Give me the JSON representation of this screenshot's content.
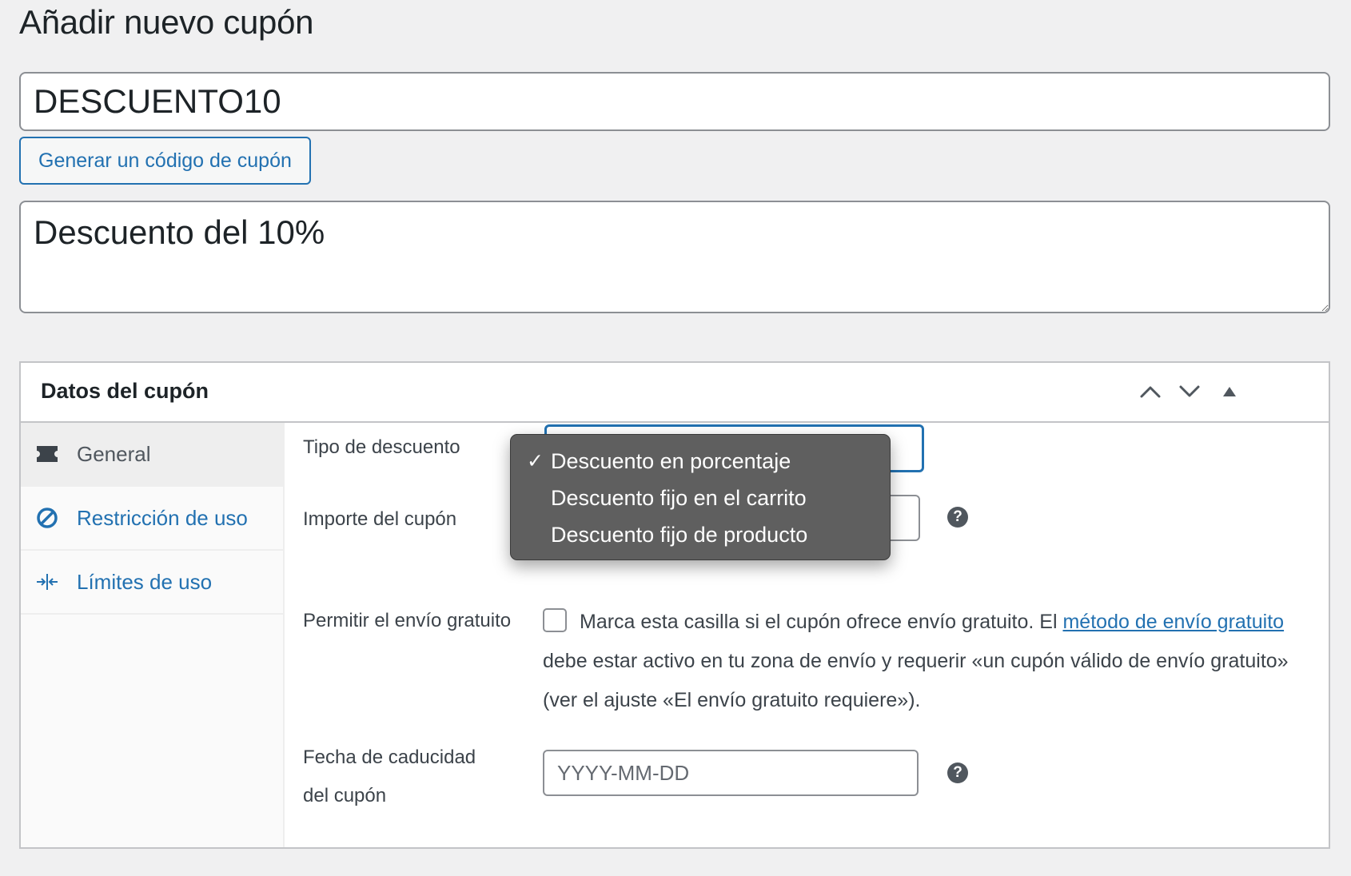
{
  "page": {
    "title": "Añadir nuevo cupón"
  },
  "coupon": {
    "code": "DESCUENTO10",
    "generate_label": "Generar un código de cupón",
    "description": "Descuento del 10%"
  },
  "panel": {
    "title": "Datos del cupón",
    "tabs": [
      {
        "label": "General",
        "icon": "ticket-icon",
        "active": true
      },
      {
        "label": "Restricción de uso",
        "icon": "prohibited-icon",
        "active": false
      },
      {
        "label": "Límites de uso",
        "icon": "arrows-in-icon",
        "active": false
      }
    ],
    "fields": {
      "discount_type_label": "Tipo de descuento",
      "amount_label": "Importe del cupón",
      "free_shipping_label": "Permitir el envío gratuito",
      "free_shipping_text_before": "Marca esta casilla si el cupón ofrece envío gratuito. El",
      "free_shipping_link": "método de envío gratuito",
      "free_shipping_text_after": "debe estar activo en tu zona de envío y requerir «un cupón válido de envío gratuito» (ver el ajuste «El envío gratuito requiere»).",
      "expiry_label_line1": "Fecha de caducidad",
      "expiry_label_line2": "del cupón",
      "expiry_placeholder": "YYYY-MM-DD"
    },
    "dropdown": {
      "check_mark": "✓",
      "options": [
        {
          "label": "Descuento en porcentaje",
          "selected": true
        },
        {
          "label": "Descuento fijo en el carrito",
          "selected": false
        },
        {
          "label": "Descuento fijo de producto",
          "selected": false
        }
      ]
    },
    "help_glyph": "?"
  },
  "colors": {
    "accent": "#2271b1",
    "background": "#f0f0f1",
    "dropdown_bg": "#5f5f5f"
  }
}
